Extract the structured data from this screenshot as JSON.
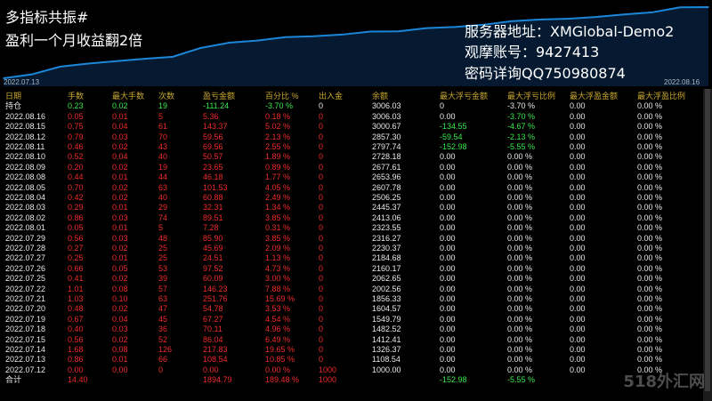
{
  "overlay": {
    "title": "多指标共振#",
    "subtitle": "盈利一个月收益翻2倍",
    "server": "服务器地址：XMGlobal-Demo2",
    "account": "观摩账号：9427413",
    "password": "密码详询QQ750980874"
  },
  "chart_data": {
    "type": "area",
    "x_start_label": "2022.07.13",
    "x_end_label": "2022.08.16",
    "x": [
      "07.12",
      "07.13",
      "07.14",
      "07.15",
      "07.18",
      "07.19",
      "07.20",
      "07.21",
      "07.22",
      "07.25",
      "07.26",
      "07.27",
      "07.28",
      "07.29",
      "08.01",
      "08.02",
      "08.03",
      "08.04",
      "08.05",
      "08.08",
      "08.09",
      "08.10",
      "08.11",
      "08.12",
      "08.15",
      "08.16"
    ],
    "values": [
      1000.0,
      1108.54,
      1326.37,
      1412.41,
      1482.52,
      1549.79,
      1604.57,
      1856.33,
      2002.56,
      2062.65,
      2160.17,
      2184.68,
      2230.37,
      2316.27,
      2323.55,
      2413.06,
      2445.37,
      2506.25,
      2607.78,
      2653.96,
      2677.61,
      2728.18,
      2797.74,
      2857.3,
      3000.67,
      3006.03
    ],
    "line_color": "#1c86d8",
    "fill_color": "#0b3a6a"
  },
  "table": {
    "headers": [
      "日期",
      "手数",
      "最大手数",
      "次数",
      "盈亏金额",
      "百分比 %",
      "出入金",
      "余额",
      "最大浮亏金额",
      "最大浮亏比例",
      "最大浮盈金额",
      "最大浮盈比例"
    ],
    "holding": [
      "持仓",
      "0.23",
      "0.02",
      "19",
      "-111.24",
      "-3.70 %",
      "0",
      "3006.03",
      "0",
      "-3.70 %",
      "0.00",
      "0.00 %"
    ],
    "rows": [
      [
        "2022.08.16",
        "0.05",
        "0.01",
        "5",
        "5.36",
        "0.18 %",
        "0",
        "3006.03",
        "0.00",
        "-3.70 %",
        "0.00",
        "0.00 %"
      ],
      [
        "2022.08.15",
        "0.75",
        "0.04",
        "61",
        "143.37",
        "5.02 %",
        "0",
        "3000.67",
        "-134.55",
        "-4.67 %",
        "0.00",
        "0.00 %"
      ],
      [
        "2022.08.12",
        "0.79",
        "0.03",
        "70",
        "59.56",
        "2.13 %",
        "0",
        "2857.30",
        "-59.54",
        "-2.13 %",
        "0.00",
        "0.00 %"
      ],
      [
        "2022.08.11",
        "0.46",
        "0.02",
        "43",
        "69.56",
        "2.55 %",
        "0",
        "2797.74",
        "-152.98",
        "-5.55 %",
        "0.00",
        "0.00 %"
      ],
      [
        "2022.08.10",
        "0.52",
        "0.04",
        "40",
        "50.57",
        "1.89 %",
        "0",
        "2728.18",
        "0.00",
        "0.00 %",
        "0.00",
        "0.00 %"
      ],
      [
        "2022.08.09",
        "0.20",
        "0.02",
        "19",
        "23.65",
        "0.89 %",
        "0",
        "2677.61",
        "0.00",
        "0.00 %",
        "0.00",
        "0.00 %"
      ],
      [
        "2022.08.08",
        "0.44",
        "0.01",
        "44",
        "46.18",
        "1.77 %",
        "0",
        "2653.96",
        "0.00",
        "0.00 %",
        "0.00",
        "0.00 %"
      ],
      [
        "2022.08.05",
        "0.70",
        "0.02",
        "63",
        "101.53",
        "4.05 %",
        "0",
        "2607.78",
        "0.00",
        "0.00 %",
        "0.00",
        "0.00 %"
      ],
      [
        "2022.08.04",
        "0.42",
        "0.02",
        "40",
        "60.88",
        "2.49 %",
        "0",
        "2506.25",
        "0.00",
        "0.00 %",
        "0.00",
        "0.00 %"
      ],
      [
        "2022.08.03",
        "0.29",
        "0.01",
        "29",
        "32.31",
        "1.34 %",
        "0",
        "2445.37",
        "0.00",
        "0.00 %",
        "0.00",
        "0.00 %"
      ],
      [
        "2022.08.02",
        "0.86",
        "0.03",
        "74",
        "89.51",
        "3.85 %",
        "0",
        "2413.06",
        "0.00",
        "0.00 %",
        "0.00",
        "0.00 %"
      ],
      [
        "2022.08.01",
        "0.05",
        "0.01",
        "5",
        "7.28",
        "0.31 %",
        "0",
        "2323.55",
        "0.00",
        "0.00 %",
        "0.00",
        "0.00 %"
      ],
      [
        "2022.07.29",
        "0.56",
        "0.03",
        "48",
        "85.90",
        "3.85 %",
        "0",
        "2316.27",
        "0.00",
        "0.00 %",
        "0.00",
        "0.00 %"
      ],
      [
        "2022.07.28",
        "0.27",
        "0.02",
        "25",
        "45.69",
        "2.09 %",
        "0",
        "2230.37",
        "0.00",
        "0.00 %",
        "0.00",
        "0.00 %"
      ],
      [
        "2022.07.27",
        "0.25",
        "0.01",
        "25",
        "24.51",
        "1.13 %",
        "0",
        "2184.68",
        "0.00",
        "0.00 %",
        "0.00",
        "0.00 %"
      ],
      [
        "2022.07.26",
        "0.66",
        "0.05",
        "53",
        "97.52",
        "4.73 %",
        "0",
        "2160.17",
        "0.00",
        "0.00 %",
        "0.00",
        "0.00 %"
      ],
      [
        "2022.07.25",
        "0.41",
        "0.02",
        "39",
        "60.09",
        "3.00 %",
        "0",
        "2062.65",
        "0.00",
        "0.00 %",
        "0.00",
        "0.00 %"
      ],
      [
        "2022.07.22",
        "1.01",
        "0.08",
        "57",
        "146.23",
        "7.88 %",
        "0",
        "2002.56",
        "0.00",
        "0.00 %",
        "0.00",
        "0.00 %"
      ],
      [
        "2022.07.21",
        "1.03",
        "0.10",
        "63",
        "251.76",
        "15.69 %",
        "0",
        "1856.33",
        "0.00",
        "0.00 %",
        "0.00",
        "0.00 %"
      ],
      [
        "2022.07.20",
        "0.48",
        "0.02",
        "47",
        "54.78",
        "3.53 %",
        "0",
        "1604.57",
        "0.00",
        "0.00 %",
        "0.00",
        "0.00 %"
      ],
      [
        "2022.07.19",
        "0.67",
        "0.04",
        "45",
        "67.27",
        "4.54 %",
        "0",
        "1549.79",
        "0.00",
        "0.00 %",
        "0.00",
        "0.00 %"
      ],
      [
        "2022.07.18",
        "0.40",
        "0.03",
        "36",
        "70.11",
        "4.96 %",
        "0",
        "1482.52",
        "0.00",
        "0.00 %",
        "0.00",
        "0.00 %"
      ],
      [
        "2022.07.15",
        "0.56",
        "0.02",
        "52",
        "86.04",
        "6.49 %",
        "0",
        "1412.41",
        "0.00",
        "0.00 %",
        "0.00",
        "0.00 %"
      ],
      [
        "2022.07.14",
        "1.68",
        "0.08",
        "126",
        "217.83",
        "19.65 %",
        "0",
        "1326.37",
        "0.00",
        "0.00 %",
        "0.00",
        "0.00 %"
      ],
      [
        "2022.07.13",
        "0.86",
        "0.01",
        "66",
        "108.54",
        "10.85 %",
        "0",
        "1108.54",
        "0.00",
        "0.00 %",
        "0.00",
        "0.00 %"
      ],
      [
        "2022.07.12",
        "0.00",
        "0.00",
        "0",
        "0.00",
        "0.00 %",
        "1000",
        "1000.00",
        "0.00",
        "0.00 %",
        "0.00",
        "0.00 %"
      ]
    ],
    "total": [
      "合计",
      "14.40",
      "",
      "",
      "1894.79",
      "189.48 %",
      "1000",
      "",
      "-152.98",
      "-5.55 %",
      "",
      ""
    ]
  },
  "watermark": "518外汇网"
}
